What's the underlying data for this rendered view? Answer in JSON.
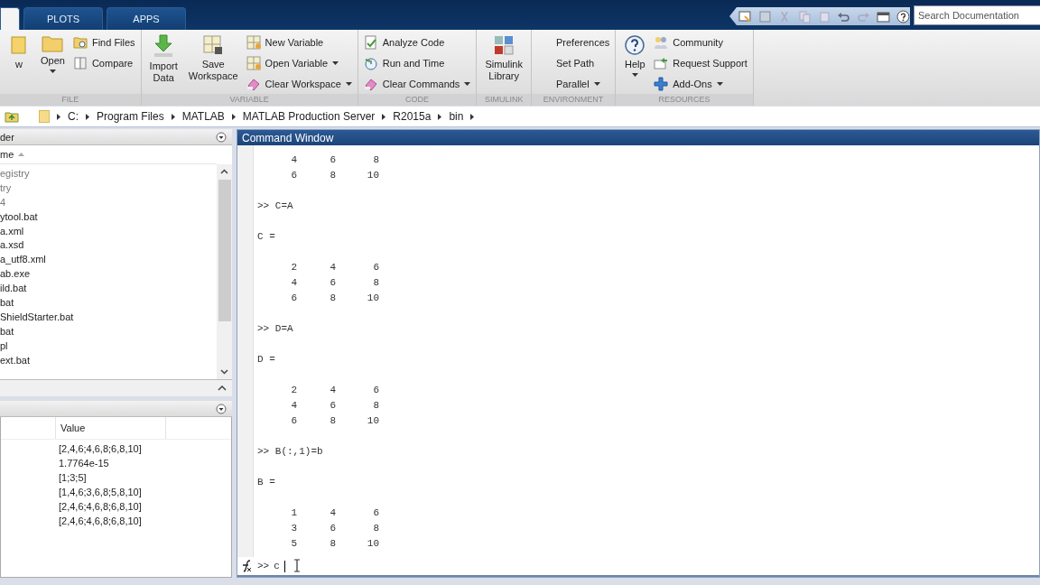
{
  "tabs": [
    {
      "selected": true
    },
    {
      "label": "PLOTS",
      "selected": false
    },
    {
      "label": "APPS",
      "selected": false
    }
  ],
  "search": {
    "placeholder": "Search Documentation"
  },
  "ribbon": {
    "sections": [
      {
        "label": "FILE",
        "columns": [
          {
            "kind": "large",
            "label": "w",
            "dropdown": false
          },
          {
            "kind": "large",
            "label": "Open",
            "dropdown": true
          },
          {
            "kind": "stack",
            "items": [
              {
                "label": "Find Files",
                "dropdown": false
              },
              {
                "label": "Compare",
                "dropdown": false
              }
            ]
          }
        ]
      },
      {
        "label": "VARIABLE",
        "columns": [
          {
            "kind": "large",
            "label": "Import Data",
            "dropdown": false
          },
          {
            "kind": "large",
            "label": "Save Workspace",
            "dropdown": false
          },
          {
            "kind": "stack",
            "items": [
              {
                "label": "New Variable",
                "dropdown": false
              },
              {
                "label": "Open Variable",
                "dropdown": true
              },
              {
                "label": "Clear Workspace",
                "dropdown": true
              }
            ]
          }
        ]
      },
      {
        "label": "CODE",
        "columns": [
          {
            "kind": "stack",
            "items": [
              {
                "label": "Analyze Code",
                "dropdown": false
              },
              {
                "label": "Run and Time",
                "dropdown": false
              },
              {
                "label": "Clear Commands",
                "dropdown": true
              }
            ]
          }
        ]
      },
      {
        "label": "SIMULINK",
        "columns": [
          {
            "kind": "large",
            "label": "Simulink Library",
            "dropdown": false
          }
        ]
      },
      {
        "label": "ENVIRONMENT",
        "columns": [
          {
            "kind": "stack",
            "items": [
              {
                "label": "Preferences",
                "dropdown": false
              },
              {
                "label": "Set Path",
                "dropdown": false
              },
              {
                "label": "Parallel",
                "dropdown": true
              }
            ]
          }
        ]
      },
      {
        "label": "RESOURCES",
        "columns": [
          {
            "kind": "large",
            "label": "Help",
            "dropdown": true
          },
          {
            "kind": "stack",
            "items": [
              {
                "label": "Community",
                "dropdown": false
              },
              {
                "label": "Request Support",
                "dropdown": false
              },
              {
                "label": "Add-Ons",
                "dropdown": true
              }
            ]
          }
        ]
      }
    ]
  },
  "address_bar": {
    "path": [
      "C:",
      "Program Files",
      "MATLAB",
      "MATLAB Production Server",
      "R2015a",
      "bin"
    ]
  },
  "current_folder": {
    "title": "der",
    "column": "me",
    "items": [
      {
        "name": "egistry",
        "kind": "folder"
      },
      {
        "name": "try",
        "kind": "folder"
      },
      {
        "name": "4",
        "kind": "folder"
      },
      {
        "name": "ytool.bat",
        "kind": "file"
      },
      {
        "name": "a.xml",
        "kind": "file"
      },
      {
        "name": "a.xsd",
        "kind": "file"
      },
      {
        "name": "a_utf8.xml",
        "kind": "file"
      },
      {
        "name": "ab.exe",
        "kind": "file"
      },
      {
        "name": "ild.bat",
        "kind": "file"
      },
      {
        "name": "bat",
        "kind": "file"
      },
      {
        "name": "ShieldStarter.bat",
        "kind": "file"
      },
      {
        "name": "bat",
        "kind": "file"
      },
      {
        "name": "pl",
        "kind": "file"
      },
      {
        "name": "ext.bat",
        "kind": "file"
      }
    ]
  },
  "workspace": {
    "column": "Value",
    "values": [
      "[2,4,6;4,6,8;6,8,10]",
      "1.7764e-15",
      "[1;3;5]",
      "[1,4,6;3,6,8;5,8,10]",
      "[2,4,6;4,6,8;6,8,10]",
      "[2,4,6;4,6,8;6,8,10]"
    ]
  },
  "command_window": {
    "title": "Command Window",
    "lines": [
      {
        "kind": "row",
        "cells": [
          "4",
          "6",
          "8"
        ]
      },
      {
        "kind": "row",
        "cells": [
          "6",
          "8",
          "10"
        ]
      },
      {
        "kind": "prompt",
        "text": ">> C=A"
      },
      {
        "kind": "name",
        "text": "C ="
      },
      {
        "kind": "row",
        "cells": [
          "2",
          "4",
          "6"
        ]
      },
      {
        "kind": "row",
        "cells": [
          "4",
          "6",
          "8"
        ]
      },
      {
        "kind": "row",
        "cells": [
          "6",
          "8",
          "10"
        ]
      },
      {
        "kind": "prompt",
        "text": ">> D=A"
      },
      {
        "kind": "name",
        "text": "D ="
      },
      {
        "kind": "row",
        "cells": [
          "2",
          "4",
          "6"
        ]
      },
      {
        "kind": "row",
        "cells": [
          "4",
          "6",
          "8"
        ]
      },
      {
        "kind": "row",
        "cells": [
          "6",
          "8",
          "10"
        ]
      },
      {
        "kind": "prompt",
        "text": ">> B(:,1)=b"
      },
      {
        "kind": "name",
        "text": "B ="
      },
      {
        "kind": "row",
        "cells": [
          "1",
          "4",
          "6"
        ]
      },
      {
        "kind": "row",
        "cells": [
          "3",
          "6",
          "8"
        ]
      },
      {
        "kind": "row",
        "cells": [
          "5",
          "8",
          "10"
        ]
      }
    ],
    "prompt": ">>",
    "input": "c"
  }
}
